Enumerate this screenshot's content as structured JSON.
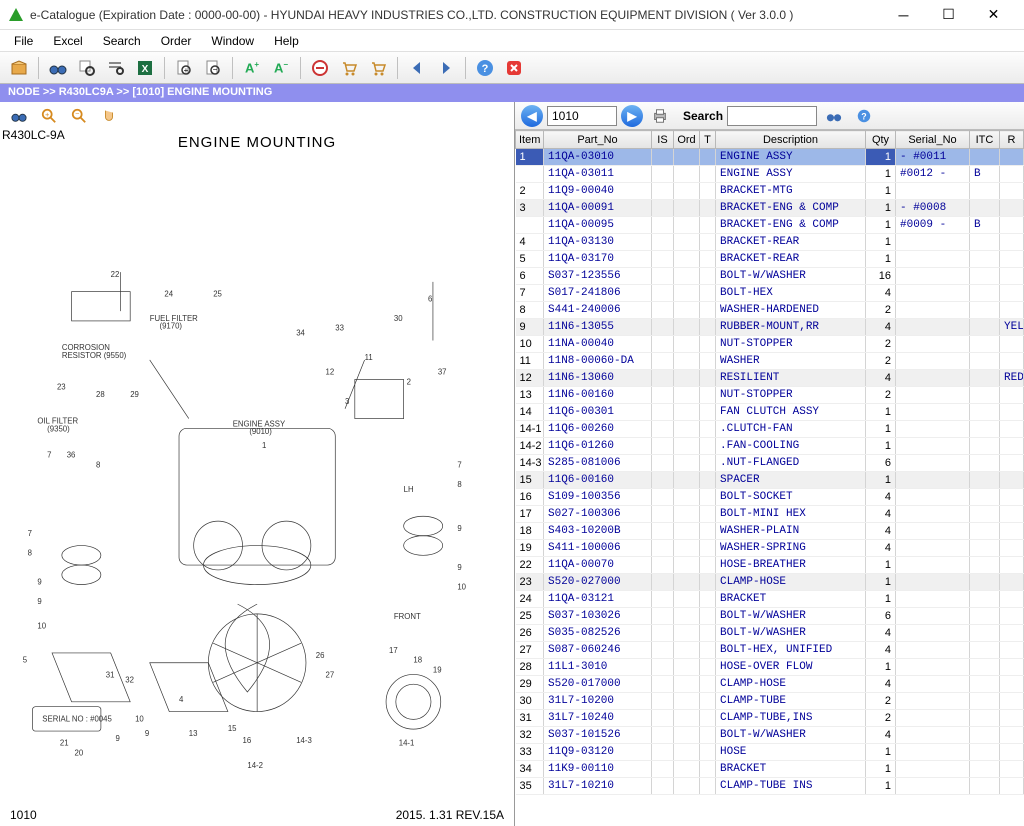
{
  "window": {
    "title": "e-Catalogue (Expiration Date : 0000-00-00)  -   HYUNDAI HEAVY INDUSTRIES CO.,LTD. CONSTRUCTION EQUIPMENT DIVISION ( Ver 3.0.0 )"
  },
  "menubar": [
    "File",
    "Excel",
    "Search",
    "Order",
    "Window",
    "Help"
  ],
  "breadcrumb": "NODE >> R430LC9A >> [1010] ENGINE MOUNTING",
  "left": {
    "model": "R430LC-9A",
    "title": "ENGINE MOUNTING",
    "footer_left": "1010",
    "footer_right": "2015. 1.31  REV.15A"
  },
  "right_toolbar": {
    "combo_value": "1010",
    "search_label": "Search",
    "search_value": ""
  },
  "table": {
    "columns": [
      "Item",
      "Part_No",
      "IS",
      "Ord",
      "T",
      "Description",
      "Qty",
      "Serial_No",
      "ITC",
      "R"
    ],
    "rows": [
      {
        "item": "1",
        "part": "11QA-03010",
        "desc": "ENGINE ASSY",
        "qty": "1",
        "serial": "   - #0011",
        "itc": "",
        "r": "",
        "sel": true
      },
      {
        "item": "",
        "part": "11QA-03011",
        "desc": "ENGINE ASSY",
        "qty": "1",
        "serial": "#0012 -",
        "itc": "B",
        "r": ""
      },
      {
        "item": "2",
        "part": "11Q9-00040",
        "desc": "BRACKET-MTG",
        "qty": "1",
        "serial": "",
        "itc": "",
        "r": ""
      },
      {
        "item": "3",
        "part": "11QA-00091",
        "desc": "BRACKET-ENG & COMP",
        "qty": "1",
        "serial": "   - #0008",
        "itc": "",
        "r": "",
        "alt": true
      },
      {
        "item": "",
        "part": "11QA-00095",
        "desc": "BRACKET-ENG & COMP",
        "qty": "1",
        "serial": "#0009 -",
        "itc": "B",
        "r": ""
      },
      {
        "item": "4",
        "part": "11QA-03130",
        "desc": "BRACKET-REAR",
        "qty": "1",
        "serial": "",
        "itc": "",
        "r": ""
      },
      {
        "item": "5",
        "part": "11QA-03170",
        "desc": "BRACKET-REAR",
        "qty": "1",
        "serial": "",
        "itc": "",
        "r": ""
      },
      {
        "item": "6",
        "part": "S037-123556",
        "desc": "BOLT-W/WASHER",
        "qty": "16",
        "serial": "",
        "itc": "",
        "r": ""
      },
      {
        "item": "7",
        "part": "S017-241806",
        "desc": "BOLT-HEX",
        "qty": "4",
        "serial": "",
        "itc": "",
        "r": ""
      },
      {
        "item": "8",
        "part": "S441-240006",
        "desc": "WASHER-HARDENED",
        "qty": "2",
        "serial": "",
        "itc": "",
        "r": ""
      },
      {
        "item": "9",
        "part": "11N6-13055",
        "desc": "RUBBER-MOUNT,RR",
        "qty": "4",
        "serial": "",
        "itc": "",
        "r": "YELLO",
        "alt": true
      },
      {
        "item": "10",
        "part": "11NA-00040",
        "desc": "NUT-STOPPER",
        "qty": "2",
        "serial": "",
        "itc": "",
        "r": ""
      },
      {
        "item": "11",
        "part": "11N8-00060-DA",
        "desc": "WASHER",
        "qty": "2",
        "serial": "",
        "itc": "",
        "r": ""
      },
      {
        "item": "12",
        "part": "11N6-13060",
        "desc": "RESILIENT",
        "qty": "4",
        "serial": "",
        "itc": "",
        "r": "RED",
        "alt": true
      },
      {
        "item": "13",
        "part": "11N6-00160",
        "desc": "NUT-STOPPER",
        "qty": "2",
        "serial": "",
        "itc": "",
        "r": ""
      },
      {
        "item": "14",
        "part": "11Q6-00301",
        "desc": "FAN CLUTCH ASSY",
        "qty": "1",
        "serial": "",
        "itc": "",
        "r": ""
      },
      {
        "item": "14-1",
        "part": "11Q6-00260",
        "desc": ".CLUTCH-FAN",
        "qty": "1",
        "serial": "",
        "itc": "",
        "r": ""
      },
      {
        "item": "14-2",
        "part": "11Q6-01260",
        "desc": ".FAN-COOLING",
        "qty": "1",
        "serial": "",
        "itc": "",
        "r": ""
      },
      {
        "item": "14-3",
        "part": "S285-081006",
        "desc": ".NUT-FLANGED",
        "qty": "6",
        "serial": "",
        "itc": "",
        "r": ""
      },
      {
        "item": "15",
        "part": "11Q6-00160",
        "desc": "SPACER",
        "qty": "1",
        "serial": "",
        "itc": "",
        "r": "",
        "alt": true
      },
      {
        "item": "16",
        "part": "S109-100356",
        "desc": "BOLT-SOCKET",
        "qty": "4",
        "serial": "",
        "itc": "",
        "r": ""
      },
      {
        "item": "17",
        "part": "S027-100306",
        "desc": "BOLT-MINI HEX",
        "qty": "4",
        "serial": "",
        "itc": "",
        "r": ""
      },
      {
        "item": "18",
        "part": "S403-10200B",
        "desc": "WASHER-PLAIN",
        "qty": "4",
        "serial": "",
        "itc": "",
        "r": ""
      },
      {
        "item": "19",
        "part": "S411-100006",
        "desc": "WASHER-SPRING",
        "qty": "4",
        "serial": "",
        "itc": "",
        "r": ""
      },
      {
        "item": "22",
        "part": "11QA-00070",
        "desc": "HOSE-BREATHER",
        "qty": "1",
        "serial": "",
        "itc": "",
        "r": ""
      },
      {
        "item": "23",
        "part": "S520-027000",
        "desc": "CLAMP-HOSE",
        "qty": "1",
        "serial": "",
        "itc": "",
        "r": "",
        "alt": true
      },
      {
        "item": "24",
        "part": "11QA-03121",
        "desc": "BRACKET",
        "qty": "1",
        "serial": "",
        "itc": "",
        "r": ""
      },
      {
        "item": "25",
        "part": "S037-103026",
        "desc": "BOLT-W/WASHER",
        "qty": "6",
        "serial": "",
        "itc": "",
        "r": ""
      },
      {
        "item": "26",
        "part": "S035-082526",
        "desc": "BOLT-W/WASHER",
        "qty": "4",
        "serial": "",
        "itc": "",
        "r": ""
      },
      {
        "item": "27",
        "part": "S087-060246",
        "desc": "BOLT-HEX, UNIFIED",
        "qty": "4",
        "serial": "",
        "itc": "",
        "r": ""
      },
      {
        "item": "28",
        "part": "11L1-3010",
        "desc": "HOSE-OVER FLOW",
        "qty": "1",
        "serial": "",
        "itc": "",
        "r": ""
      },
      {
        "item": "29",
        "part": "S520-017000",
        "desc": "CLAMP-HOSE",
        "qty": "4",
        "serial": "",
        "itc": "",
        "r": ""
      },
      {
        "item": "30",
        "part": "31L7-10200",
        "desc": "CLAMP-TUBE",
        "qty": "2",
        "serial": "",
        "itc": "",
        "r": ""
      },
      {
        "item": "31",
        "part": "31L7-10240",
        "desc": "CLAMP-TUBE,INS",
        "qty": "2",
        "serial": "",
        "itc": "",
        "r": ""
      },
      {
        "item": "32",
        "part": "S037-101526",
        "desc": "BOLT-W/WASHER",
        "qty": "4",
        "serial": "",
        "itc": "",
        "r": ""
      },
      {
        "item": "33",
        "part": "11Q9-03120",
        "desc": "HOSE",
        "qty": "1",
        "serial": "",
        "itc": "",
        "r": ""
      },
      {
        "item": "34",
        "part": "11K9-00110",
        "desc": "BRACKET",
        "qty": "1",
        "serial": "",
        "itc": "",
        "r": ""
      },
      {
        "item": "35",
        "part": "31L7-10210",
        "desc": "CLAMP-TUBE INS",
        "qty": "1",
        "serial": "",
        "itc": "",
        "r": ""
      }
    ]
  }
}
